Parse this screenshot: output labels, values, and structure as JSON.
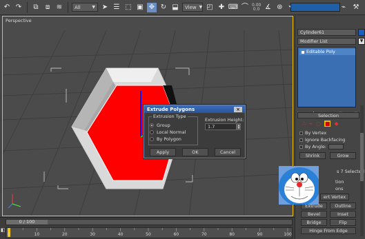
{
  "toolbar": {
    "selection_filter": "All",
    "ref_coord": "View",
    "spinner_top": "0.00",
    "spinner_bottom": "0.0"
  },
  "viewport": {
    "label": "Perspective"
  },
  "dialog": {
    "title": "Extrude Polygons",
    "close_glyph": "×",
    "type_group_label": "Extrusion Type",
    "options": [
      "Group",
      "Local Normal",
      "By Polygon"
    ],
    "selected_option": "Group",
    "height_label": "Extrusion Height:",
    "height_value": "1.7",
    "apply_label": "Apply",
    "ok_label": "OK",
    "cancel_label": "Cancel"
  },
  "panel": {
    "object_name": "Cylinder61",
    "object_color": "#1a5fc0",
    "modifier_list": "Modifier List",
    "stack_item": "Editable Poly",
    "selection_rollout": "Selection",
    "by_vertex": "By Vertex",
    "ignore_backfacing": "Ignore Backfacing",
    "by_angle": "By Angle:",
    "shrink": "Shrink",
    "grow": "Grow",
    "selected_count": "s 7 Selected",
    "edit_polygons_partial": "tion",
    "insert_vertex_partial": "ons",
    "insert_vertex": "ert Vertex",
    "extrude": "Extrude",
    "outline": "Outline",
    "bevel": "Bevel",
    "inset": "Inset",
    "bridge": "Bridge",
    "flip": "Flip",
    "hinge_from_edge": "Hinge From Edge"
  },
  "timeline": {
    "frame_label": "0 / 100",
    "ticks": [
      "0",
      "10",
      "20",
      "30",
      "40",
      "50",
      "60",
      "70",
      "80",
      "90",
      "100"
    ]
  },
  "colors": {
    "accent": "#f5c300",
    "polygon_red": "#ff0000",
    "selection_blue": "#3a6fb3"
  }
}
